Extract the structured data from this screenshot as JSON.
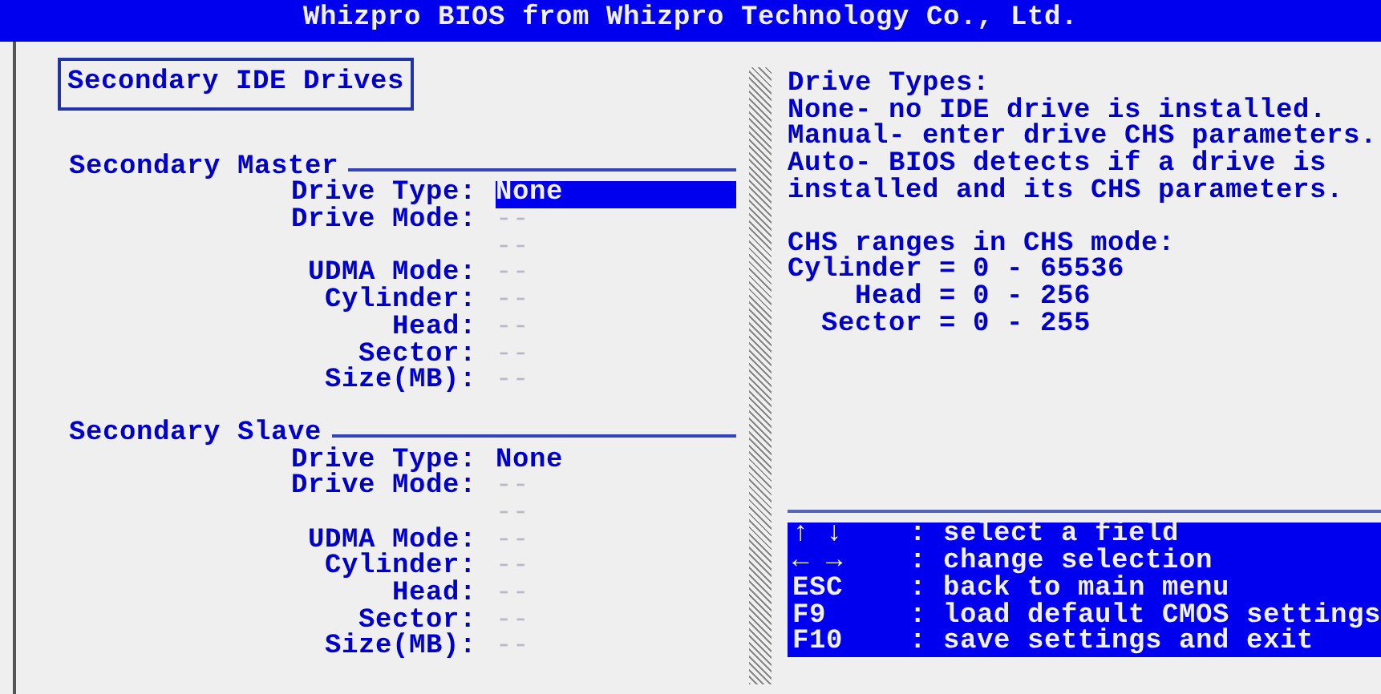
{
  "window": {
    "title": "Whizpro BIOS from Whizpro Technology Co., Ltd."
  },
  "page_title": "Secondary IDE Drives",
  "groups": [
    {
      "title": "Secondary Master",
      "fields": [
        {
          "label": "Drive Type:",
          "value": "None",
          "selected": true,
          "disabled": false
        },
        {
          "label": "Drive Mode:",
          "value": "--",
          "selected": false,
          "disabled": true
        },
        {
          "value": "--",
          "selected": false,
          "disabled": true
        },
        {
          "label": "UDMA Mode:",
          "value": "--",
          "selected": false,
          "disabled": true
        },
        {
          "label": "Cylinder:",
          "value": "--",
          "selected": false,
          "disabled": true
        },
        {
          "label": "Head:",
          "value": "--",
          "selected": false,
          "disabled": true
        },
        {
          "label": "Sector:",
          "value": "--",
          "selected": false,
          "disabled": true
        },
        {
          "label": "Size(MB):",
          "value": "--",
          "selected": false,
          "disabled": true
        }
      ]
    },
    {
      "title": "Secondary Slave",
      "fields": [
        {
          "label": "Drive Type:",
          "value": "None",
          "selected": false,
          "disabled": false
        },
        {
          "label": "Drive Mode:",
          "value": "--",
          "selected": false,
          "disabled": true
        },
        {
          "value": "--",
          "selected": false,
          "disabled": true
        },
        {
          "label": "UDMA Mode:",
          "value": "--",
          "selected": false,
          "disabled": true
        },
        {
          "label": "Cylinder:",
          "value": "--",
          "selected": false,
          "disabled": true
        },
        {
          "label": "Head:",
          "value": "--",
          "selected": false,
          "disabled": true
        },
        {
          "label": "Sector:",
          "value": "--",
          "selected": false,
          "disabled": true
        },
        {
          "label": "Size(MB):",
          "value": "--",
          "selected": false,
          "disabled": true
        }
      ]
    }
  ],
  "help": {
    "paragraphs": [
      [
        "Drive Types:",
        "None- no IDE drive is installed.",
        "Manual- enter drive CHS parameters.",
        "Auto- BIOS detects if a drive is",
        "installed and its CHS parameters."
      ],
      [
        "CHS ranges in CHS mode:",
        "Cylinder = 0 - 65536",
        "    Head = 0 - 256",
        "  Sector = 0 - 255"
      ]
    ]
  },
  "keys": [
    {
      "key": "↑ ↓",
      "action": ": select a field"
    },
    {
      "key": "← →",
      "action": ": change selection"
    },
    {
      "key": "ESC",
      "action": ": back to main menu"
    },
    {
      "key": "F9",
      "action": ": load default CMOS settings"
    },
    {
      "key": "F10",
      "action": ": save settings and exit"
    }
  ]
}
